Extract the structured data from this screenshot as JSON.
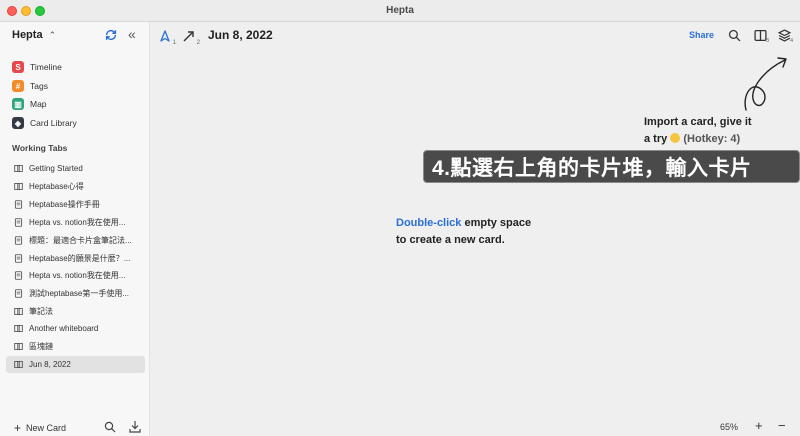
{
  "window": {
    "title": "Hepta"
  },
  "sidebar": {
    "workspace": "Hepta",
    "nav": [
      {
        "label": "Timeline",
        "icon": "timeline-icon",
        "color": "#e5484d"
      },
      {
        "label": "Tags",
        "icon": "tag-icon",
        "color": "#f38b2a"
      },
      {
        "label": "Map",
        "icon": "map-icon",
        "color": "#2fa37c"
      },
      {
        "label": "Card Library",
        "icon": "card-library-icon",
        "color": "#333a44"
      }
    ],
    "working_tabs_title": "Working Tabs",
    "tabs": [
      {
        "label": "Getting Started",
        "type": "whiteboard"
      },
      {
        "label": "Heptabase心得",
        "type": "whiteboard"
      },
      {
        "label": "Heptabase操作手冊",
        "type": "card"
      },
      {
        "label": "Hepta vs. notion我在使用...",
        "type": "card"
      },
      {
        "label": "標題：最適合卡片盒筆記法...",
        "type": "card"
      },
      {
        "label": "Heptabase的願景是什麼？...",
        "type": "card"
      },
      {
        "label": "Hepta vs. notion我在使用...",
        "type": "card"
      },
      {
        "label": "測試heptabase第一手使用...",
        "type": "card"
      },
      {
        "label": "筆記法",
        "type": "whiteboard"
      },
      {
        "label": "Another whiteboard",
        "type": "whiteboard"
      },
      {
        "label": "區塊鏈",
        "type": "whiteboard"
      },
      {
        "label": "Jun 8, 2022",
        "type": "whiteboard",
        "active": true
      }
    ],
    "new_card_label": "New Card"
  },
  "toolbar": {
    "select_tool_hotkey": "1",
    "arrow_tool_hotkey": "2",
    "title": "Jun 8, 2022",
    "share_label": "Share",
    "split_view_hotkey": "3",
    "card_stack_hotkey": "4"
  },
  "canvas": {
    "hint_link": "Double-click",
    "hint_rest_line1": " empty space",
    "hint_line2": "to create a new card.",
    "import_line1": "Import a card, give it",
    "import_line2_prefix": "a try",
    "import_hotkey": "(Hotkey: 4)",
    "banner": "4.點選右上角的卡片堆，輸入卡片"
  },
  "zoom": {
    "level": "65%",
    "in_label": "+",
    "out_label": "−"
  },
  "colors": {
    "accent": "#2a6fd6"
  }
}
